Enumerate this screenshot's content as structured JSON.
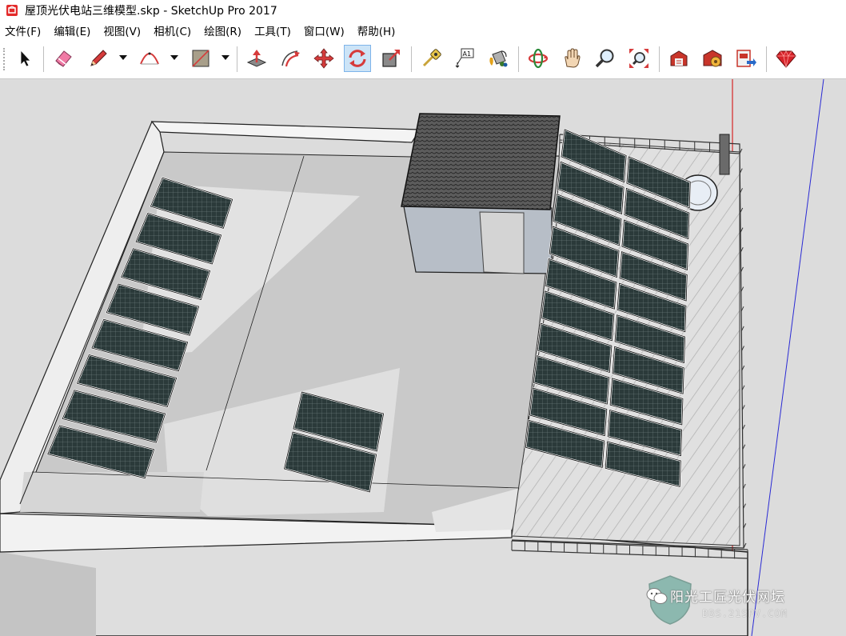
{
  "window": {
    "title": "屋顶光伏电站三维模型.skp - SketchUp Pro 2017",
    "app_icon": "sketchup-logo-icon"
  },
  "menu": {
    "items": [
      "文件(F)",
      "编辑(E)",
      "视图(V)",
      "相机(C)",
      "绘图(R)",
      "工具(T)",
      "窗口(W)",
      "帮助(H)"
    ]
  },
  "toolbar": {
    "tools": [
      {
        "icon": "select-arrow-icon"
      },
      {
        "icon": "eraser-icon"
      },
      {
        "icon": "pencil-line-icon"
      },
      {
        "icon": "arc-icon"
      },
      {
        "icon": "rectangle-icon"
      },
      {
        "icon": "push-pull-icon"
      },
      {
        "icon": "offset-icon"
      },
      {
        "icon": "move-icon"
      },
      {
        "icon": "rotate-icon"
      },
      {
        "icon": "scale-icon"
      },
      {
        "icon": "tape-measure-icon"
      },
      {
        "icon": "text-label-icon"
      },
      {
        "icon": "paint-bucket-icon"
      },
      {
        "icon": "orbit-icon"
      },
      {
        "icon": "pan-hand-icon"
      },
      {
        "icon": "zoom-icon"
      },
      {
        "icon": "zoom-extents-icon"
      },
      {
        "icon": "3d-warehouse-icon"
      },
      {
        "icon": "extension-warehouse-icon"
      },
      {
        "icon": "layout-send-icon"
      },
      {
        "icon": "ruby-console-icon"
      }
    ],
    "active_tool": "rotate-icon",
    "text_tool_glyph": "A1"
  },
  "model": {
    "panel_color": "#2b3a3a",
    "roof_color": "#c8c8c8",
    "wall_color": "#e6e6e6"
  },
  "watermark": {
    "name": "阳光工匠光伏网坛",
    "url": "BBS.21SPV.COM",
    "icon": "wechat-icon"
  }
}
